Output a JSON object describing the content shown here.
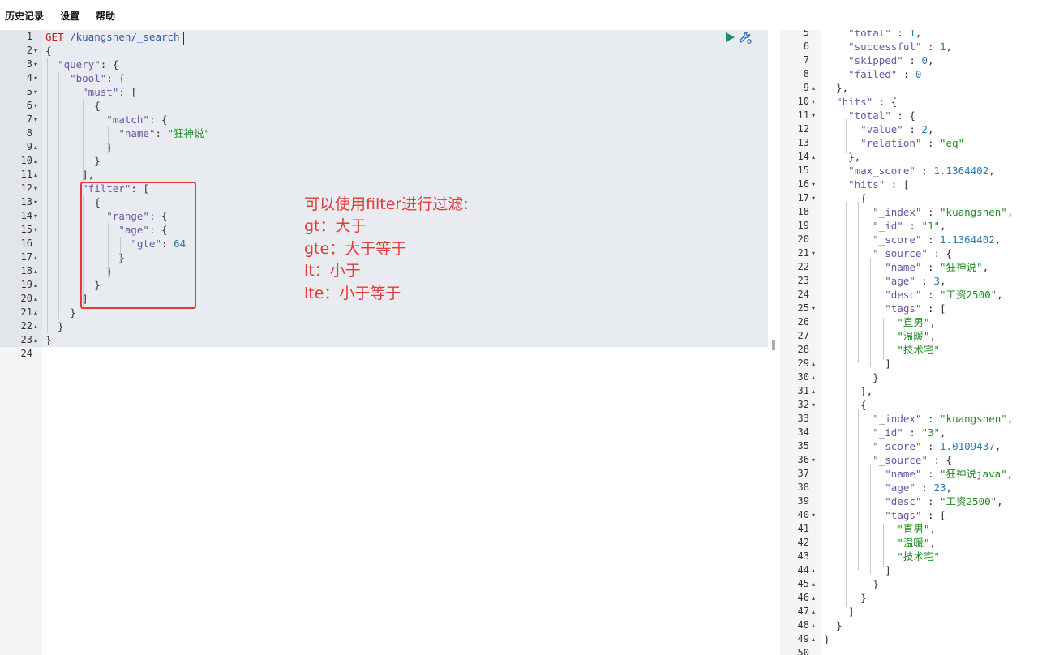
{
  "menu": {
    "history": "历史记录",
    "settings": "设置",
    "help": "帮助"
  },
  "icons": {
    "run": "play-icon",
    "wrench": "wrench-icon"
  },
  "annotation": {
    "lines": [
      "可以使用filter进行过滤:",
      "gt：大于",
      "gte：大于等于",
      "lt：小于",
      "lte：小于等于"
    ]
  },
  "colors": {
    "accent_red": "#e53935",
    "method": "#c41a16",
    "string": "#228b22",
    "key": "#6b56a6",
    "number": "#2a7ab0"
  },
  "request_editor": {
    "lines": [
      {
        "n": "1",
        "fold": "",
        "segs": [
          [
            "m",
            "GET"
          ],
          [
            "p",
            " "
          ],
          [
            "u",
            "/kuangshen/_search"
          ]
        ]
      },
      {
        "n": "2",
        "fold": "▾",
        "segs": [
          [
            "p",
            "{"
          ]
        ]
      },
      {
        "n": "3",
        "fold": "▾",
        "segs": [
          [
            "p",
            "  "
          ],
          [
            "k",
            "\"query\""
          ],
          [
            "p",
            ": {"
          ]
        ]
      },
      {
        "n": "4",
        "fold": "▾",
        "segs": [
          [
            "p",
            "    "
          ],
          [
            "k",
            "\"bool\""
          ],
          [
            "p",
            ": {"
          ]
        ]
      },
      {
        "n": "5",
        "fold": "▾",
        "segs": [
          [
            "p",
            "      "
          ],
          [
            "k",
            "\"must\""
          ],
          [
            "p",
            ": ["
          ]
        ]
      },
      {
        "n": "6",
        "fold": "▾",
        "segs": [
          [
            "p",
            "        {"
          ]
        ]
      },
      {
        "n": "7",
        "fold": "▾",
        "segs": [
          [
            "p",
            "          "
          ],
          [
            "k",
            "\"match\""
          ],
          [
            "p",
            ": {"
          ]
        ]
      },
      {
        "n": "8",
        "fold": "",
        "segs": [
          [
            "p",
            "            "
          ],
          [
            "k",
            "\"name\""
          ],
          [
            "p",
            ": "
          ],
          [
            "s",
            "\"狂神说\""
          ]
        ]
      },
      {
        "n": "9",
        "fold": "▴",
        "segs": [
          [
            "p",
            "          }"
          ]
        ]
      },
      {
        "n": "10",
        "fold": "▴",
        "segs": [
          [
            "p",
            "        }"
          ]
        ]
      },
      {
        "n": "11",
        "fold": "▴",
        "segs": [
          [
            "p",
            "      ],"
          ]
        ]
      },
      {
        "n": "12",
        "fold": "▾",
        "segs": [
          [
            "p",
            "      "
          ],
          [
            "k",
            "\"filter\""
          ],
          [
            "p",
            ": ["
          ]
        ]
      },
      {
        "n": "13",
        "fold": "▾",
        "segs": [
          [
            "p",
            "        {"
          ]
        ]
      },
      {
        "n": "14",
        "fold": "▾",
        "segs": [
          [
            "p",
            "          "
          ],
          [
            "k",
            "\"range\""
          ],
          [
            "p",
            ": {"
          ]
        ]
      },
      {
        "n": "15",
        "fold": "▾",
        "segs": [
          [
            "p",
            "            "
          ],
          [
            "k",
            "\"age\""
          ],
          [
            "p",
            ": {"
          ]
        ]
      },
      {
        "n": "16",
        "fold": "",
        "segs": [
          [
            "p",
            "              "
          ],
          [
            "k",
            "\"gte\""
          ],
          [
            "p",
            ": "
          ],
          [
            "n",
            "64"
          ]
        ]
      },
      {
        "n": "17",
        "fold": "▴",
        "segs": [
          [
            "p",
            "            }"
          ]
        ]
      },
      {
        "n": "18",
        "fold": "▴",
        "segs": [
          [
            "p",
            "          }"
          ]
        ]
      },
      {
        "n": "19",
        "fold": "▴",
        "segs": [
          [
            "p",
            "        }"
          ]
        ]
      },
      {
        "n": "20",
        "fold": "▴",
        "segs": [
          [
            "p",
            "      ]"
          ]
        ]
      },
      {
        "n": "21",
        "fold": "▴",
        "segs": [
          [
            "p",
            "    }"
          ]
        ]
      },
      {
        "n": "22",
        "fold": "▴",
        "segs": [
          [
            "p",
            "  }"
          ]
        ]
      },
      {
        "n": "23",
        "fold": "▴",
        "segs": [
          [
            "p",
            "}"
          ]
        ]
      },
      {
        "n": "24",
        "fold": "",
        "segs": []
      }
    ]
  },
  "response_editor": {
    "lines": [
      {
        "n": "5",
        "fold": "",
        "segs": [
          [
            "p",
            "    "
          ],
          [
            "k",
            "\"total\""
          ],
          [
            "p",
            " : "
          ],
          [
            "n",
            "1"
          ],
          [
            "p",
            ","
          ]
        ]
      },
      {
        "n": "6",
        "fold": "",
        "segs": [
          [
            "p",
            "    "
          ],
          [
            "k",
            "\"successful\""
          ],
          [
            "p",
            " : "
          ],
          [
            "n",
            "1"
          ],
          [
            "p",
            ","
          ]
        ]
      },
      {
        "n": "7",
        "fold": "",
        "segs": [
          [
            "p",
            "    "
          ],
          [
            "k",
            "\"skipped\""
          ],
          [
            "p",
            " : "
          ],
          [
            "n",
            "0"
          ],
          [
            "p",
            ","
          ]
        ]
      },
      {
        "n": "8",
        "fold": "",
        "segs": [
          [
            "p",
            "    "
          ],
          [
            "k",
            "\"failed\""
          ],
          [
            "p",
            " : "
          ],
          [
            "n",
            "0"
          ]
        ]
      },
      {
        "n": "9",
        "fold": "▴",
        "segs": [
          [
            "p",
            "  },"
          ]
        ]
      },
      {
        "n": "10",
        "fold": "▾",
        "segs": [
          [
            "p",
            "  "
          ],
          [
            "k",
            "\"hits\""
          ],
          [
            "p",
            " : {"
          ]
        ]
      },
      {
        "n": "11",
        "fold": "▾",
        "segs": [
          [
            "p",
            "    "
          ],
          [
            "k",
            "\"total\""
          ],
          [
            "p",
            " : {"
          ]
        ]
      },
      {
        "n": "12",
        "fold": "",
        "segs": [
          [
            "p",
            "      "
          ],
          [
            "k",
            "\"value\""
          ],
          [
            "p",
            " : "
          ],
          [
            "n",
            "2"
          ],
          [
            "p",
            ","
          ]
        ]
      },
      {
        "n": "13",
        "fold": "",
        "segs": [
          [
            "p",
            "      "
          ],
          [
            "k",
            "\"relation\""
          ],
          [
            "p",
            " : "
          ],
          [
            "s",
            "\"eq\""
          ]
        ]
      },
      {
        "n": "14",
        "fold": "▴",
        "segs": [
          [
            "p",
            "    },"
          ]
        ]
      },
      {
        "n": "15",
        "fold": "",
        "segs": [
          [
            "p",
            "    "
          ],
          [
            "k",
            "\"max_score\""
          ],
          [
            "p",
            " : "
          ],
          [
            "n",
            "1.1364402"
          ],
          [
            "p",
            ","
          ]
        ]
      },
      {
        "n": "16",
        "fold": "▾",
        "segs": [
          [
            "p",
            "    "
          ],
          [
            "k",
            "\"hits\""
          ],
          [
            "p",
            " : ["
          ]
        ]
      },
      {
        "n": "17",
        "fold": "▾",
        "segs": [
          [
            "p",
            "      {"
          ]
        ]
      },
      {
        "n": "18",
        "fold": "",
        "segs": [
          [
            "p",
            "        "
          ],
          [
            "k",
            "\"_index\""
          ],
          [
            "p",
            " : "
          ],
          [
            "s",
            "\"kuangshen\""
          ],
          [
            "p",
            ","
          ]
        ]
      },
      {
        "n": "19",
        "fold": "",
        "segs": [
          [
            "p",
            "        "
          ],
          [
            "k",
            "\"_id\""
          ],
          [
            "p",
            " : "
          ],
          [
            "s",
            "\"1\""
          ],
          [
            "p",
            ","
          ]
        ]
      },
      {
        "n": "20",
        "fold": "",
        "segs": [
          [
            "p",
            "        "
          ],
          [
            "k",
            "\"_score\""
          ],
          [
            "p",
            " : "
          ],
          [
            "n",
            "1.1364402"
          ],
          [
            "p",
            ","
          ]
        ]
      },
      {
        "n": "21",
        "fold": "▾",
        "segs": [
          [
            "p",
            "        "
          ],
          [
            "k",
            "\"_source\""
          ],
          [
            "p",
            " : {"
          ]
        ]
      },
      {
        "n": "22",
        "fold": "",
        "segs": [
          [
            "p",
            "          "
          ],
          [
            "k",
            "\"name\""
          ],
          [
            "p",
            " : "
          ],
          [
            "s",
            "\"狂神说\""
          ],
          [
            "p",
            ","
          ]
        ]
      },
      {
        "n": "23",
        "fold": "",
        "segs": [
          [
            "p",
            "          "
          ],
          [
            "k",
            "\"age\""
          ],
          [
            "p",
            " : "
          ],
          [
            "n",
            "3"
          ],
          [
            "p",
            ","
          ]
        ]
      },
      {
        "n": "24",
        "fold": "",
        "segs": [
          [
            "p",
            "          "
          ],
          [
            "k",
            "\"desc\""
          ],
          [
            "p",
            " : "
          ],
          [
            "s",
            "\"工资2500\""
          ],
          [
            "p",
            ","
          ]
        ]
      },
      {
        "n": "25",
        "fold": "▾",
        "segs": [
          [
            "p",
            "          "
          ],
          [
            "k",
            "\"tags\""
          ],
          [
            "p",
            " : ["
          ]
        ]
      },
      {
        "n": "26",
        "fold": "",
        "segs": [
          [
            "p",
            "            "
          ],
          [
            "s",
            "\"直男\""
          ],
          [
            "p",
            ","
          ]
        ]
      },
      {
        "n": "27",
        "fold": "",
        "segs": [
          [
            "p",
            "            "
          ],
          [
            "s",
            "\"温暖\""
          ],
          [
            "p",
            ","
          ]
        ]
      },
      {
        "n": "28",
        "fold": "",
        "segs": [
          [
            "p",
            "            "
          ],
          [
            "s",
            "\"技术宅\""
          ]
        ]
      },
      {
        "n": "29",
        "fold": "▴",
        "segs": [
          [
            "p",
            "          ]"
          ]
        ]
      },
      {
        "n": "30",
        "fold": "▴",
        "segs": [
          [
            "p",
            "        }"
          ]
        ]
      },
      {
        "n": "31",
        "fold": "▴",
        "segs": [
          [
            "p",
            "      },"
          ]
        ]
      },
      {
        "n": "32",
        "fold": "▾",
        "segs": [
          [
            "p",
            "      {"
          ]
        ]
      },
      {
        "n": "33",
        "fold": "",
        "segs": [
          [
            "p",
            "        "
          ],
          [
            "k",
            "\"_index\""
          ],
          [
            "p",
            " : "
          ],
          [
            "s",
            "\"kuangshen\""
          ],
          [
            "p",
            ","
          ]
        ]
      },
      {
        "n": "34",
        "fold": "",
        "segs": [
          [
            "p",
            "        "
          ],
          [
            "k",
            "\"_id\""
          ],
          [
            "p",
            " : "
          ],
          [
            "s",
            "\"3\""
          ],
          [
            "p",
            ","
          ]
        ]
      },
      {
        "n": "35",
        "fold": "",
        "segs": [
          [
            "p",
            "        "
          ],
          [
            "k",
            "\"_score\""
          ],
          [
            "p",
            " : "
          ],
          [
            "n",
            "1.0109437"
          ],
          [
            "p",
            ","
          ]
        ]
      },
      {
        "n": "36",
        "fold": "▾",
        "segs": [
          [
            "p",
            "        "
          ],
          [
            "k",
            "\"_source\""
          ],
          [
            "p",
            " : {"
          ]
        ]
      },
      {
        "n": "37",
        "fold": "",
        "segs": [
          [
            "p",
            "          "
          ],
          [
            "k",
            "\"name\""
          ],
          [
            "p",
            " : "
          ],
          [
            "s",
            "\"狂神说java\""
          ],
          [
            "p",
            ","
          ]
        ]
      },
      {
        "n": "38",
        "fold": "",
        "segs": [
          [
            "p",
            "          "
          ],
          [
            "k",
            "\"age\""
          ],
          [
            "p",
            " : "
          ],
          [
            "n",
            "23"
          ],
          [
            "p",
            ","
          ]
        ]
      },
      {
        "n": "39",
        "fold": "",
        "segs": [
          [
            "p",
            "          "
          ],
          [
            "k",
            "\"desc\""
          ],
          [
            "p",
            " : "
          ],
          [
            "s",
            "\"工资2500\""
          ],
          [
            "p",
            ","
          ]
        ]
      },
      {
        "n": "40",
        "fold": "▾",
        "segs": [
          [
            "p",
            "          "
          ],
          [
            "k",
            "\"tags\""
          ],
          [
            "p",
            " : ["
          ]
        ]
      },
      {
        "n": "41",
        "fold": "",
        "segs": [
          [
            "p",
            "            "
          ],
          [
            "s",
            "\"直男\""
          ],
          [
            "p",
            ","
          ]
        ]
      },
      {
        "n": "42",
        "fold": "",
        "segs": [
          [
            "p",
            "            "
          ],
          [
            "s",
            "\"温暖\""
          ],
          [
            "p",
            ","
          ]
        ]
      },
      {
        "n": "43",
        "fold": "",
        "segs": [
          [
            "p",
            "            "
          ],
          [
            "s",
            "\"技术宅\""
          ]
        ]
      },
      {
        "n": "44",
        "fold": "▴",
        "segs": [
          [
            "p",
            "          ]"
          ]
        ]
      },
      {
        "n": "45",
        "fold": "▴",
        "segs": [
          [
            "p",
            "        }"
          ]
        ]
      },
      {
        "n": "46",
        "fold": "▴",
        "segs": [
          [
            "p",
            "      }"
          ]
        ]
      },
      {
        "n": "47",
        "fold": "▴",
        "segs": [
          [
            "p",
            "    ]"
          ]
        ]
      },
      {
        "n": "48",
        "fold": "▴",
        "segs": [
          [
            "p",
            "  }"
          ]
        ]
      },
      {
        "n": "49",
        "fold": "▴",
        "segs": [
          [
            "p",
            "}"
          ]
        ]
      },
      {
        "n": "50",
        "fold": "",
        "segs": []
      }
    ]
  }
}
